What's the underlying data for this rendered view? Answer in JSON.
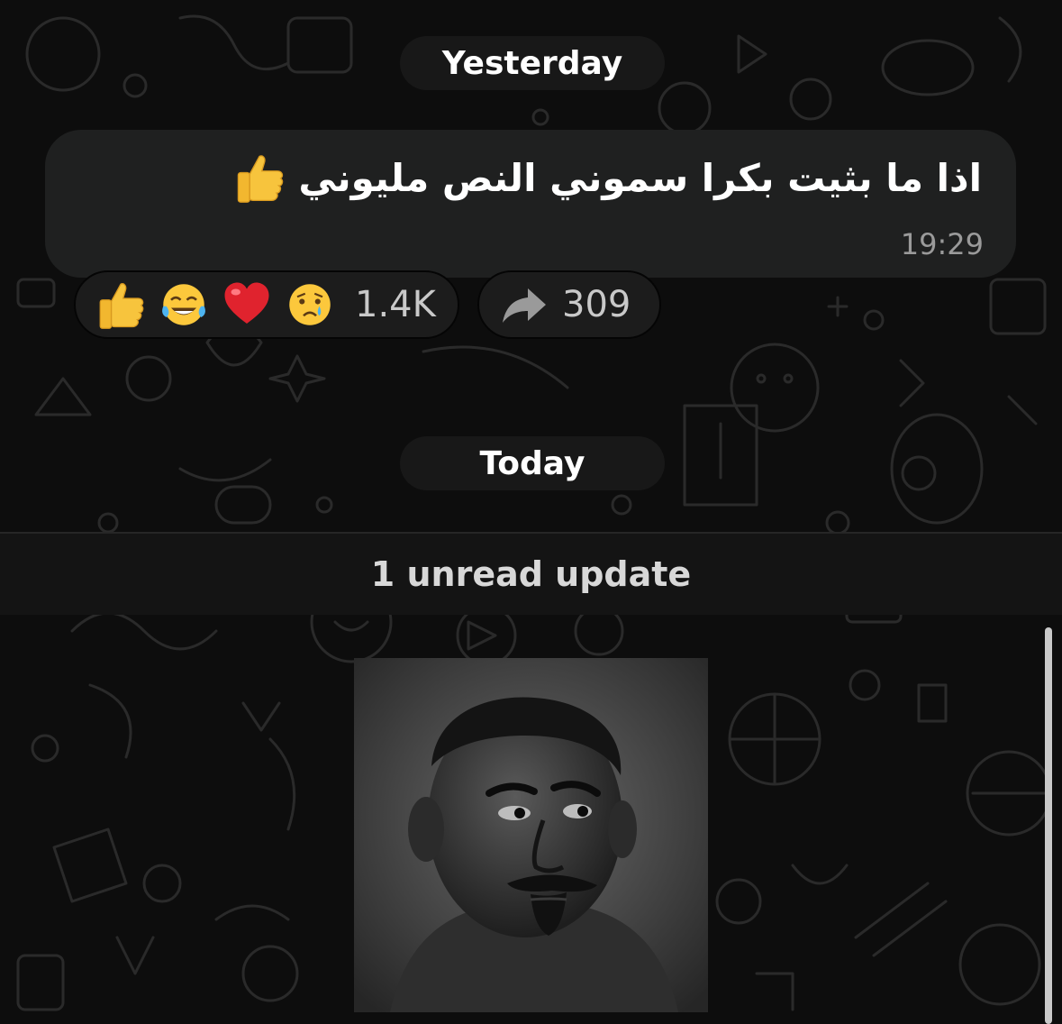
{
  "separators": {
    "yesterday": "Yesterday",
    "today": "Today"
  },
  "message": {
    "text": "اذا ما بثيت بكرا سموني النص مليوني",
    "time": "19:29"
  },
  "reactions": {
    "emojis": [
      "thumbs-up",
      "tears-of-joy",
      "red-heart",
      "crying-face"
    ],
    "count": "1.4K"
  },
  "forwards": {
    "icon": "share-arrow-icon",
    "count": "309"
  },
  "unread": {
    "label": "1 unread update"
  },
  "colors": {
    "background": "#0d0d0d",
    "bubble": "#1f2020",
    "pill": "#181818",
    "muted_text": "#9a9a9a"
  }
}
